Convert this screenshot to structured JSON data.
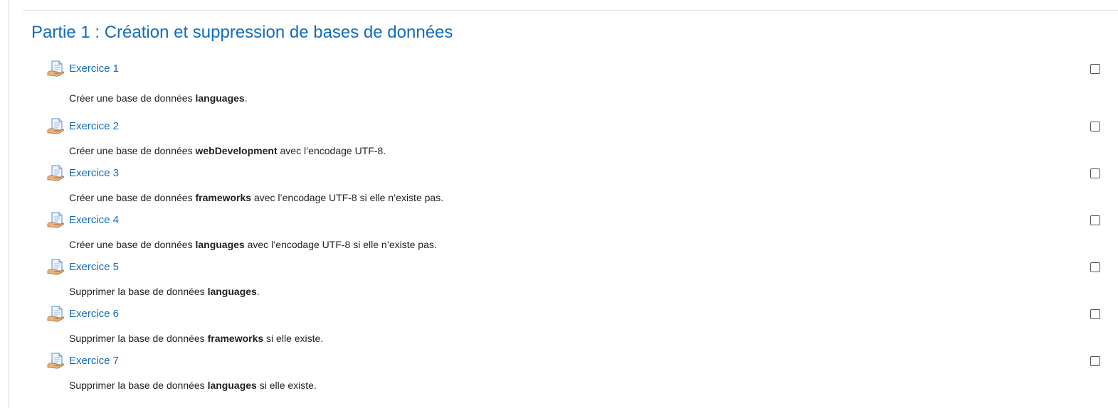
{
  "section": {
    "title": "Partie 1 : Création et suppression de bases de données"
  },
  "activities": [
    {
      "name": "Exercice 1",
      "icon": "page-icon",
      "completion": false,
      "desc_before": "Créer une base de données ",
      "desc_bold": "languages",
      "desc_after": "."
    },
    {
      "name": "Exercice 2",
      "icon": "page-icon",
      "completion": false,
      "desc_before": "Créer une base de données ",
      "desc_bold": "webDevelopment",
      "desc_after": " avec l’encodage UTF-8."
    },
    {
      "name": "Exercice 3",
      "icon": "page-icon",
      "completion": false,
      "desc_before": "Créer une base de données ",
      "desc_bold": "frameworks",
      "desc_after": " avec l’encodage UTF-8 si elle n’existe pas."
    },
    {
      "name": "Exercice 4",
      "icon": "page-icon",
      "completion": false,
      "desc_before": "Créer une base de données ",
      "desc_bold": "languages",
      "desc_after": " avec l’encodage UTF-8 si elle n’existe pas."
    },
    {
      "name": "Exercice 5",
      "icon": "page-icon",
      "completion": false,
      "desc_before": "Supprimer la base de données ",
      "desc_bold": "languages",
      "desc_after": "."
    },
    {
      "name": "Exercice 6",
      "icon": "page-icon",
      "completion": false,
      "desc_before": "Supprimer la base de données ",
      "desc_bold": "frameworks",
      "desc_after": " si elle existe."
    },
    {
      "name": "Exercice 7",
      "icon": "page-icon",
      "completion": false,
      "desc_before": "Supprimer la base de données ",
      "desc_bold": "languages",
      "desc_after": " si elle existe."
    }
  ],
  "colors": {
    "link": "#0f6cbf",
    "text": "#1d2125",
    "divider": "#dee2e6"
  }
}
